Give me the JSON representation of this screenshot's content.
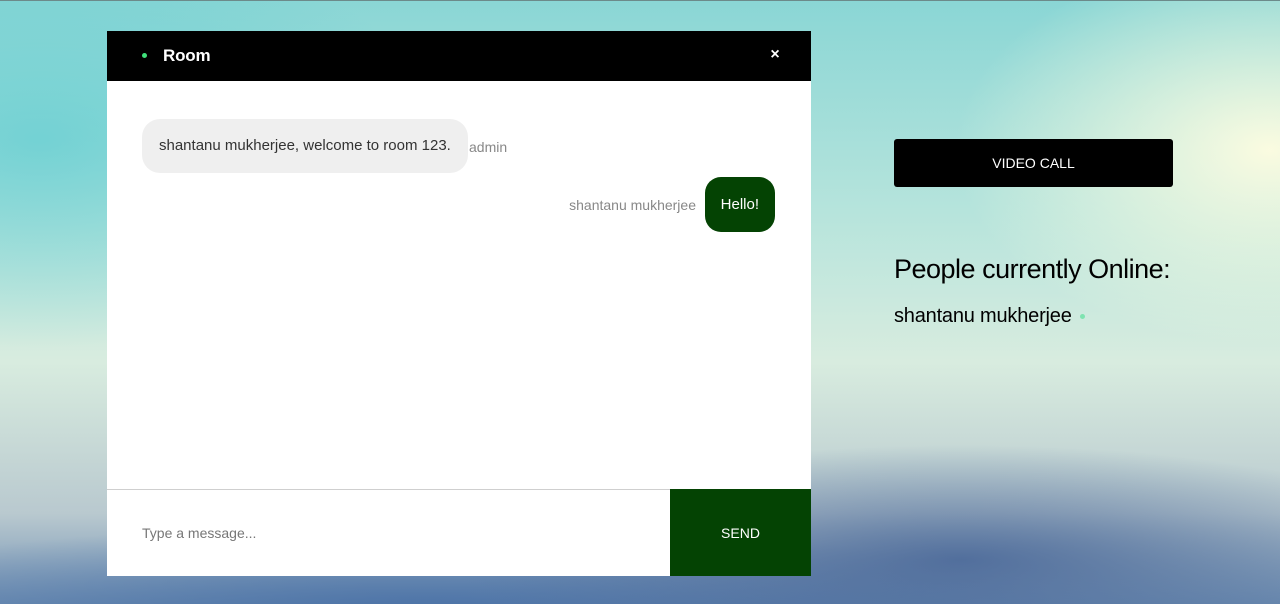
{
  "chat": {
    "room_title": "Room",
    "close_label": "×",
    "messages": [
      {
        "text": "shantanu mukherjee, welcome to room 123.",
        "sender": "admin",
        "direction": "incoming"
      },
      {
        "text": "Hello!",
        "sender": "shantanu mukherjee",
        "direction": "outgoing"
      }
    ],
    "input_placeholder": "Type a message...",
    "input_value": "",
    "send_label": "SEND"
  },
  "sidebar": {
    "video_call_label": "VIDEO CALL",
    "online_heading": "People currently Online:",
    "online_users": [
      "shantanu mukherjee"
    ]
  },
  "colors": {
    "header_bg": "#000000",
    "accent_green": "#044303",
    "online_indicator": "#3fe07a",
    "incoming_bubble": "#efefef"
  },
  "icons": {
    "online_dot": "status-dot-icon",
    "close": "close-icon"
  }
}
